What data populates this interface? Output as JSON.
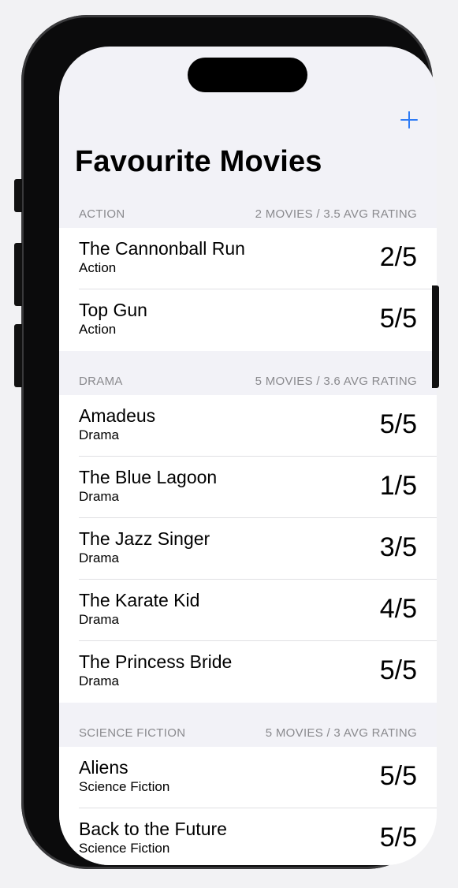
{
  "nav": {
    "title": "Favourite Movies",
    "add_icon": "plus-icon"
  },
  "sections": [
    {
      "header": "ACTION",
      "summary": "2 MOVIES / 3.5 AVG RATING",
      "movies": [
        {
          "title": "The Cannonball Run",
          "genre": "Action",
          "rating": "2/5"
        },
        {
          "title": "Top Gun",
          "genre": "Action",
          "rating": "5/5"
        }
      ]
    },
    {
      "header": "DRAMA",
      "summary": "5 MOVIES / 3.6 AVG RATING",
      "movies": [
        {
          "title": "Amadeus",
          "genre": "Drama",
          "rating": "5/5"
        },
        {
          "title": "The Blue Lagoon",
          "genre": "Drama",
          "rating": "1/5"
        },
        {
          "title": "The Jazz Singer",
          "genre": "Drama",
          "rating": "3/5"
        },
        {
          "title": "The Karate Kid",
          "genre": "Drama",
          "rating": "4/5"
        },
        {
          "title": "The Princess Bride",
          "genre": "Drama",
          "rating": "5/5"
        }
      ]
    },
    {
      "header": "SCIENCE FICTION",
      "summary": "5 MOVIES / 3 AVG RATING",
      "movies": [
        {
          "title": "Aliens",
          "genre": "Science Fiction",
          "rating": "5/5"
        },
        {
          "title": "Back to the Future",
          "genre": "Science Fiction",
          "rating": "5/5"
        }
      ]
    }
  ]
}
